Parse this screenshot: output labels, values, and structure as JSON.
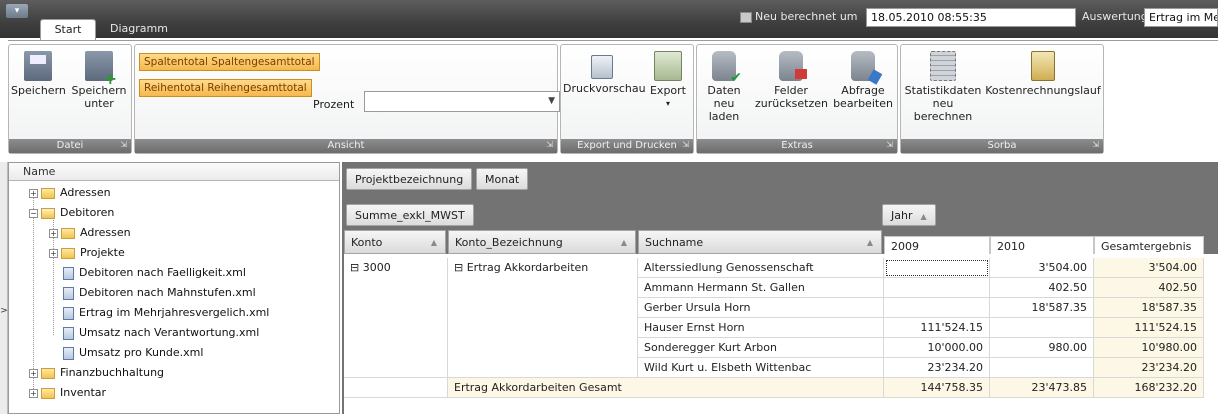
{
  "titlebar": {
    "qat_glyph": "▾",
    "tabs": [
      {
        "label": "Start"
      },
      {
        "label": "Diagramm"
      }
    ],
    "calc_label": "Neu berechnet um",
    "calc_value": "18.05.2010 08:55:35",
    "eval_label": "Auswertung:",
    "eval_value": "Ertrag im Me"
  },
  "ribbon": {
    "datei": {
      "footer": "Datei",
      "save": "Speichern",
      "save_under_1": "Speichern",
      "save_under_2": "unter"
    },
    "ansicht": {
      "footer": "Ansicht",
      "spaltentotal": "Spaltentotal",
      "spaltengesamttotal": "Spaltengesamttotal",
      "reihentotal": "Reihentotal",
      "reihengesamttotal": "Reihengesamttotal",
      "prozent_label": "Prozent",
      "prozent_value": ""
    },
    "export": {
      "footer": "Export und Drucken",
      "druckvorschau": "Druckvorschau",
      "export": "Export",
      "export_arrow": "▾"
    },
    "extras": {
      "footer": "Extras",
      "daten_1": "Daten neu",
      "daten_2": "laden",
      "felder_1": "Felder",
      "felder_2": "zurücksetzen",
      "abfrage_1": "Abfrage",
      "abfrage_2": "bearbeiten"
    },
    "sorba": {
      "footer": "Sorba",
      "stat_1": "Statistikdaten",
      "stat_2": "neu berechnen",
      "kosten": "Kostenrechnungslauf"
    },
    "launcher": "⇲"
  },
  "tree": {
    "header": "Name",
    "collapse_glyph": ">",
    "items": [
      {
        "label": "Adressen",
        "pm": "+"
      },
      {
        "label": "Debitoren",
        "pm": "−"
      },
      {
        "label": "Adressen",
        "pm": "+"
      },
      {
        "label": "Projekte",
        "pm": "+"
      },
      {
        "label": "Debitoren nach Faelligkeit.xml"
      },
      {
        "label": "Debitoren nach Mahnstufen.xml"
      },
      {
        "label": "Ertrag im Mehrjahresvergelich.xml"
      },
      {
        "label": "Umsatz nach Verantwortung.xml"
      },
      {
        "label": "Umsatz pro Kunde.xml"
      },
      {
        "label": "Finanzbuchhaltung",
        "pm": "+"
      },
      {
        "label": "Inventar",
        "pm": "+"
      }
    ]
  },
  "pivot": {
    "filter_fields": [
      "Projektbezeichnung",
      "Monat"
    ],
    "data_field": "Summe_exkl_MWST",
    "column_field": "Jahr",
    "sort_glyph": "▲",
    "row_headers": [
      "Konto",
      "Konto_Bezeichnung",
      "Suchname"
    ],
    "col_headers": [
      "2009",
      "2010",
      "Gesamtergebnis"
    ],
    "konto": "3000",
    "bezeichnung": "Ertrag Akkordarbeiten",
    "expand_glyph": "⊟",
    "rows": [
      {
        "suchname": "Alterssiedlung Genossenschaft",
        "y2009": "",
        "y2010": "3'504.00",
        "total": "3'504.00"
      },
      {
        "suchname": "Ammann Hermann St. Gallen",
        "y2009": "",
        "y2010": "402.50",
        "total": "402.50"
      },
      {
        "suchname": "Gerber Ursula Horn",
        "y2009": "",
        "y2010": "18'587.35",
        "total": "18'587.35"
      },
      {
        "suchname": "Hauser Ernst Horn",
        "y2009": "111'524.15",
        "y2010": "",
        "total": "111'524.15"
      },
      {
        "suchname": "Sonderegger Kurt Arbon",
        "y2009": "10'000.00",
        "y2010": "980.00",
        "total": "10'980.00"
      },
      {
        "suchname": "Wild Kurt u. Elsbeth Wittenbac",
        "y2009": "23'234.20",
        "y2010": "",
        "total": "23'234.20"
      }
    ],
    "subtotal": {
      "label": "Ertrag Akkordarbeiten Gesamt",
      "y2009": "144'758.35",
      "y2010": "23'473.85",
      "total": "168'232.20"
    }
  }
}
